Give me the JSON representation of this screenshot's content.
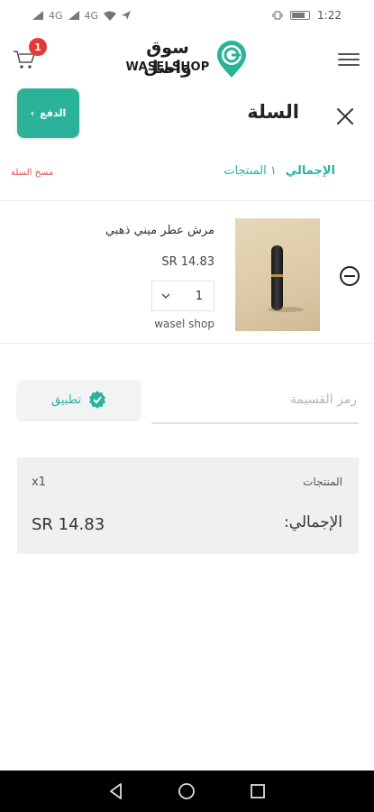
{
  "status_bar": {
    "left_indicators": [
      "4G",
      "4G"
    ],
    "time": "1:22"
  },
  "header": {
    "cart_count": "1",
    "logo_arabic": "سوق واصل",
    "logo_english": "WASELSHOP",
    "brand_color": "#2bb39a"
  },
  "cart": {
    "title": "السلة",
    "checkout_label": "الدفع",
    "clear_label": "مسح السلة",
    "total_label": "الإجمالي",
    "items_summary": "١ المنتجات"
  },
  "product": {
    "name": "مرش عطر ميني ذهبي",
    "price": "SR 14.83",
    "quantity": "1",
    "vendor": "wasel shop"
  },
  "coupon": {
    "placeholder": "رمز القسيمة",
    "apply_label": "تطبيق"
  },
  "summary": {
    "items_label": "المنتجات",
    "items_count": "x1",
    "total_label": "الإجمالي:",
    "total_value": "SR 14.83"
  },
  "colors": {
    "accent": "#2bb39a",
    "danger": "#d9534f",
    "badge": "#e53935"
  }
}
